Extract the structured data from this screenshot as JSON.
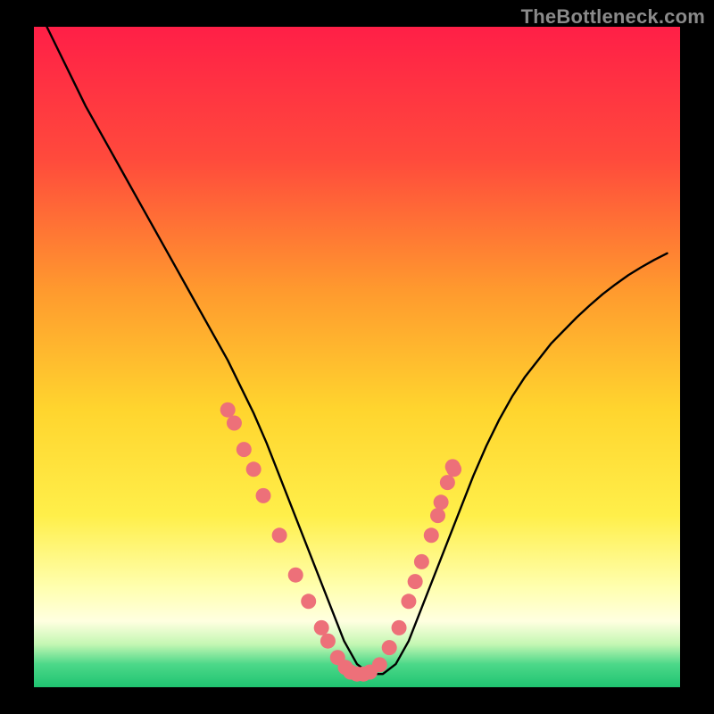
{
  "watermark": "TheBottleneck.com",
  "chart_data": {
    "type": "line",
    "title": "",
    "xlabel": "",
    "ylabel": "",
    "xlim": [
      0,
      100
    ],
    "ylim": [
      0,
      100
    ],
    "legend": false,
    "background_gradient_stops": [
      {
        "offset": 0.0,
        "color": "#ff1f47"
      },
      {
        "offset": 0.2,
        "color": "#ff4a3c"
      },
      {
        "offset": 0.4,
        "color": "#ff9a2e"
      },
      {
        "offset": 0.58,
        "color": "#ffd52e"
      },
      {
        "offset": 0.74,
        "color": "#ffef4a"
      },
      {
        "offset": 0.85,
        "color": "#ffffb0"
      },
      {
        "offset": 0.9,
        "color": "#ffffe0"
      },
      {
        "offset": 0.935,
        "color": "#c4f7b3"
      },
      {
        "offset": 0.965,
        "color": "#4dd889"
      },
      {
        "offset": 1.0,
        "color": "#1fc471"
      }
    ],
    "series": [
      {
        "name": "bottleneck-curve",
        "type": "curve",
        "x": [
          2,
          4,
          6,
          8,
          10,
          12,
          14,
          16,
          18,
          20,
          22,
          24,
          26,
          28,
          30,
          32,
          34,
          36,
          38,
          40,
          42,
          44,
          46,
          48,
          50,
          52,
          54,
          56,
          58,
          60,
          62,
          64,
          66,
          68,
          70,
          72,
          74,
          76,
          78,
          80,
          82,
          84,
          86,
          88,
          90,
          92,
          94,
          96,
          98
        ],
        "y": [
          100,
          96,
          92,
          88,
          84.5,
          81,
          77.5,
          74,
          70.5,
          67,
          63.5,
          60,
          56.5,
          53,
          49.5,
          45.5,
          41.5,
          37,
          32,
          27,
          22,
          17,
          12,
          7,
          3.5,
          2,
          2,
          3.5,
          7,
          12,
          17,
          22,
          27,
          32,
          36.5,
          40.5,
          44,
          47,
          49.5,
          52,
          54,
          56,
          57.8,
          59.5,
          61,
          62.4,
          63.6,
          64.7,
          65.7
        ]
      },
      {
        "name": "data-points",
        "type": "scatter",
        "x": [
          30,
          31,
          32.5,
          34,
          35.5,
          38,
          40.5,
          42.5,
          44.5,
          45.5,
          47,
          48.2,
          49,
          50,
          51,
          52,
          53.5,
          55,
          56.5,
          58,
          59,
          60,
          61.5,
          62.5,
          63,
          64,
          65,
          64.8
        ],
        "y": [
          42,
          40,
          36,
          33,
          29,
          23,
          17,
          13,
          9,
          7,
          4.5,
          3,
          2.3,
          2,
          2,
          2.3,
          3.4,
          6,
          9,
          13,
          16,
          19,
          23,
          26,
          28,
          31,
          33,
          33.4
        ]
      }
    ],
    "marker_color": "#ed7079",
    "curve_color": "#000000"
  }
}
